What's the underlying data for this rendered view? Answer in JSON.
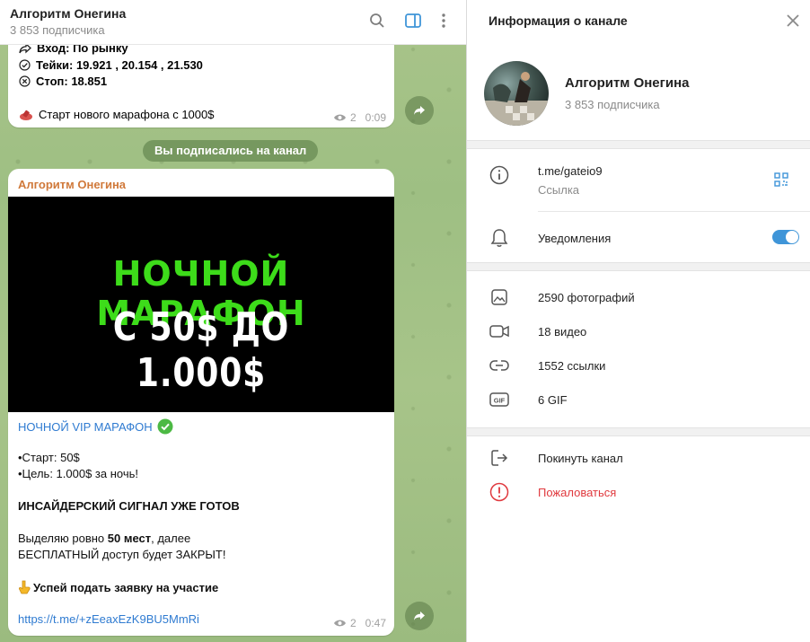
{
  "chat": {
    "title": "Алгоритм Онегина",
    "subtitle": "3 853 подписчика",
    "msg1": {
      "entry": "Вход: По рынку",
      "takes": "Тейки: 19.921 , 20.154 , 21.530",
      "stop": "Стоп: 18.851",
      "marathon": "Старт нового марафона с 1000$",
      "views": "2",
      "time": "0:09"
    },
    "service": "Вы подписались на канал",
    "msg2": {
      "sender": "Алгоритм Онегина",
      "banner_line1": "НОЧНОЙ МАРАФОН",
      "banner_line2": "С 50$ ДО 1.000$",
      "vip_title": "НОЧНОЙ VIP МАРАФОН",
      "start": "•Старт: 50$",
      "goal": "•Цель: 1.000$ за ночь!",
      "insider": "ИНСАЙДЕРСКИЙ СИГНАЛ УЖЕ ГОТОВ",
      "places_prefix": "Выделяю ровно ",
      "places_bold": "50 мест",
      "places_suffix": ", далее",
      "closed": "БЕСПЛАТНЫЙ доступ будет ЗАКРЫТ!",
      "apply": "Успей подать заявку на участие",
      "invite_link": "https://t.me/+zEeaxEzK9BU5MmRi",
      "views": "2",
      "time": "0:47"
    }
  },
  "info": {
    "title": "Информация о канале",
    "name": "Алгоритм Онегина",
    "subscribers": "3 853 подписчика",
    "link": "t.me/gateio9",
    "link_caption": "Ссылка",
    "notifications": "Уведомления",
    "notifications_on": true,
    "photos": "2590 фотографий",
    "videos": "18 видео",
    "links": "1552 ссылки",
    "gifs": "6 GIF",
    "leave": "Покинуть канал",
    "report": "Пожаловаться"
  },
  "colors": {
    "accent": "#3f95d8",
    "link": "#2f7bd1",
    "sender": "#d0793a",
    "danger": "#e0393e",
    "banner_green": "#3ddc1a"
  }
}
